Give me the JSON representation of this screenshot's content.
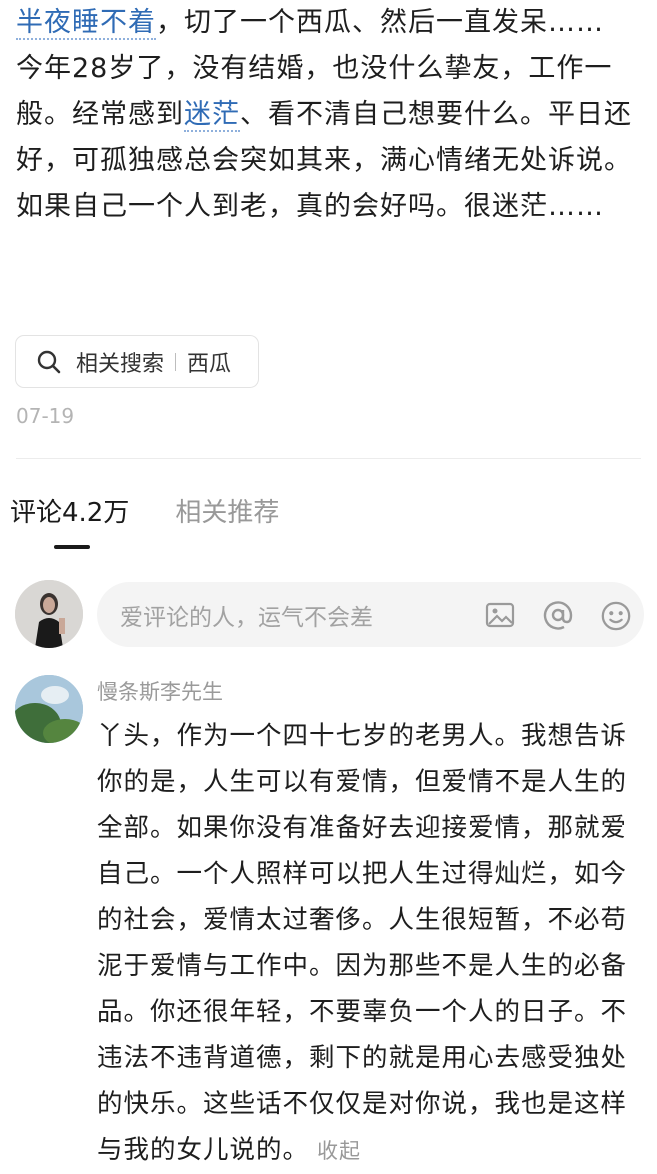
{
  "post": {
    "link_keyword_1": "半夜睡不着",
    "para1_rest": "，切了一个西瓜、然后一直发呆……",
    "para2_before": "今年28岁了，没有结婚，也没什么挚友，工作一般。经常感到",
    "link_keyword_2": "迷茫",
    "para2_after": "、看不清自己想要什么。平日还好，可孤独感总会突如其来，满心情绪无处诉说。如果自己一个人到老，真的会好吗。很迷茫……",
    "related_search_label": "相关搜索",
    "related_search_term": "西瓜",
    "date": "07-19"
  },
  "tabs": {
    "comments_label": "评论4.2万",
    "related_label": "相关推荐"
  },
  "comment_box": {
    "placeholder": "爱评论的人，运气不会差"
  },
  "comment": {
    "author": "慢条斯李先生",
    "text": "丫头，作为一个四十七岁的老男人。我想告诉你的是，人生可以有爱情，但爱情不是人生的全部。如果你没有准备好去迎接爱情，那就爱自己。一个人照样可以把人生过得灿烂，如今的社会，爱情太过奢侈。人生很短暂，不必苟泥于爱情与工作中。因为那些不是人生的必备品。你还很年轻，不要辜负一个人的日子。不违法不违背道德，剩下的就是用心去感受独处的快乐。这些话不仅仅是对你说，我也是这样与我的女儿说的。",
    "collapse_label": "收起"
  },
  "icons": {
    "search": "search-icon",
    "image": "image-icon",
    "mention": "at-mention-icon",
    "emoji": "emoji-icon"
  },
  "colors": {
    "link": "#2f6bb5",
    "muted": "#999999",
    "text": "#1e1e1e"
  }
}
